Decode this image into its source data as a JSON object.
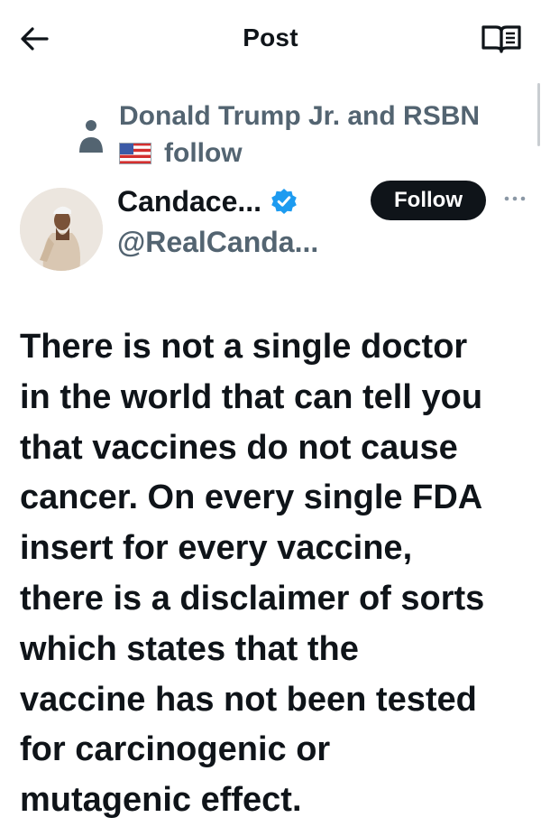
{
  "header": {
    "title": "Post",
    "back_icon": "arrow-left-icon",
    "reader_icon": "book-open-icon"
  },
  "social_context": {
    "icon": "person-icon",
    "names": "Donald Trump Jr. and RSBN",
    "flag_icon": "us-flag-icon",
    "action": "follow"
  },
  "author": {
    "display_name": "Candace...",
    "handle": "@RealCanda...",
    "verified": true,
    "follow_label": "Follow",
    "more_icon": "more-horizontal-icon"
  },
  "tweet": {
    "lines": [
      "There is not a single doctor",
      "in the world that can tell you",
      "that vaccines do not cause",
      "cancer. On every single FDA",
      "insert for every vaccine,",
      "there is a disclaimer of sorts",
      "which states that the",
      "vaccine has not been tested",
      "for carcinogenic or",
      "mutagenic effect."
    ]
  },
  "colors": {
    "text_primary": "#0f1419",
    "text_secondary": "#536471",
    "verified_blue": "#1d9bf0",
    "follow_button_bg": "#0f1419"
  }
}
